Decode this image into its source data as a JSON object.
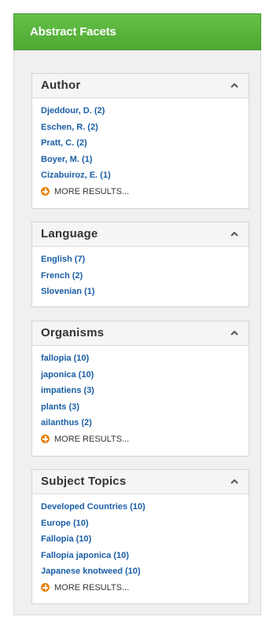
{
  "panel": {
    "title": "Abstract Facets"
  },
  "facets": [
    {
      "title": "Author",
      "items": [
        "Djeddour, D. (2)",
        "Eschen, R. (2)",
        "Pratt, C. (2)",
        "Boyer, M. (1)",
        "Cizabuiroz, E. (1)"
      ],
      "more_label": "MORE RESULTS..."
    },
    {
      "title": "Language",
      "items": [
        "English (7)",
        "French (2)",
        "Slovenian (1)"
      ]
    },
    {
      "title": "Organisms",
      "items": [
        "fallopia (10)",
        "japonica (10)",
        "impatiens (3)",
        "plants (3)",
        "ailanthus (2)"
      ],
      "more_label": "MORE RESULTS..."
    },
    {
      "title": "Subject Topics",
      "items": [
        "Developed Countries (10)",
        "Europe (10)",
        "Fallopia (10)",
        "Fallopia japonica (10)",
        "Japanese knotweed (10)"
      ],
      "more_label": "MORE RESULTS..."
    }
  ],
  "icons": {
    "collapse": "chevron-up-icon",
    "more": "plus-circle-icon"
  },
  "colors": {
    "header_green": "#5cb83f",
    "link_blue": "#1a5fa6",
    "more_orange": "#e8830e"
  }
}
